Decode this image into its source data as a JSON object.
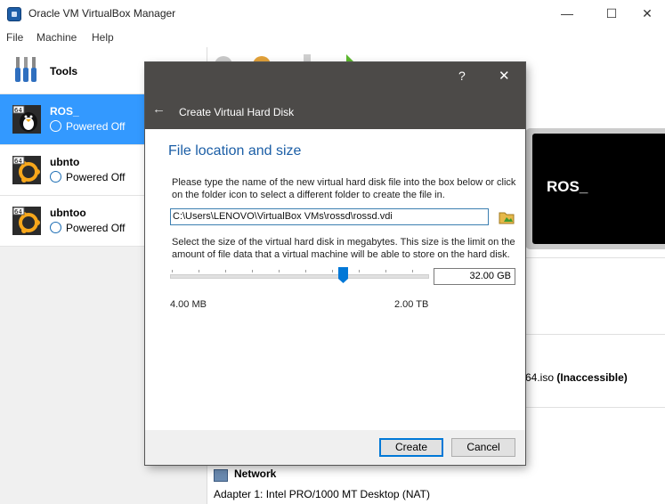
{
  "window": {
    "title": "Oracle VM VirtualBox Manager",
    "minimize": "—",
    "maximize": "☐",
    "close": "✕"
  },
  "menu": {
    "items": [
      "File",
      "Machine",
      "Help"
    ]
  },
  "sidebar": {
    "tools_label": "Tools",
    "vms": [
      {
        "name": "ROS_",
        "status": "Powered Off",
        "selected": true
      },
      {
        "name": "ubnto",
        "status": "Powered Off",
        "selected": false
      },
      {
        "name": "ubntoo",
        "status": "Powered Off",
        "selected": false
      }
    ]
  },
  "details": {
    "preview_name": "ROS_",
    "storage_iso_suffix": "64.iso",
    "storage_iso_state": "(Inaccessible)",
    "network_title": "Network",
    "network_adapter": "Adapter 1:   Intel PRO/1000 MT Desktop (NAT)"
  },
  "dialog": {
    "title": "Create Virtual Hard Disk",
    "help": "?",
    "close": "✕",
    "back": "←",
    "section_title": "File location and size",
    "location_instructions": "Please type the name of the new virtual hard disk file into the box below or click on the folder icon to select a different folder to create the file in.",
    "file_path": "C:\\Users\\LENOVO\\VirtualBox VMs\\rossd\\rossd.vdi",
    "size_instructions": "Select the size of the virtual hard disk in megabytes. This size is the limit on the amount of file data that a virtual machine will be able to store on the hard disk.",
    "size_value": "32.00 GB",
    "size_min": "4.00 MB",
    "size_max": "2.00 TB",
    "create_button": "Create",
    "cancel_button": "Cancel"
  },
  "colors": {
    "selection": "#3399ff",
    "dialog_header": "#4c4a48",
    "section_title": "#1b5ea6",
    "accent_blue": "#0078d7"
  }
}
